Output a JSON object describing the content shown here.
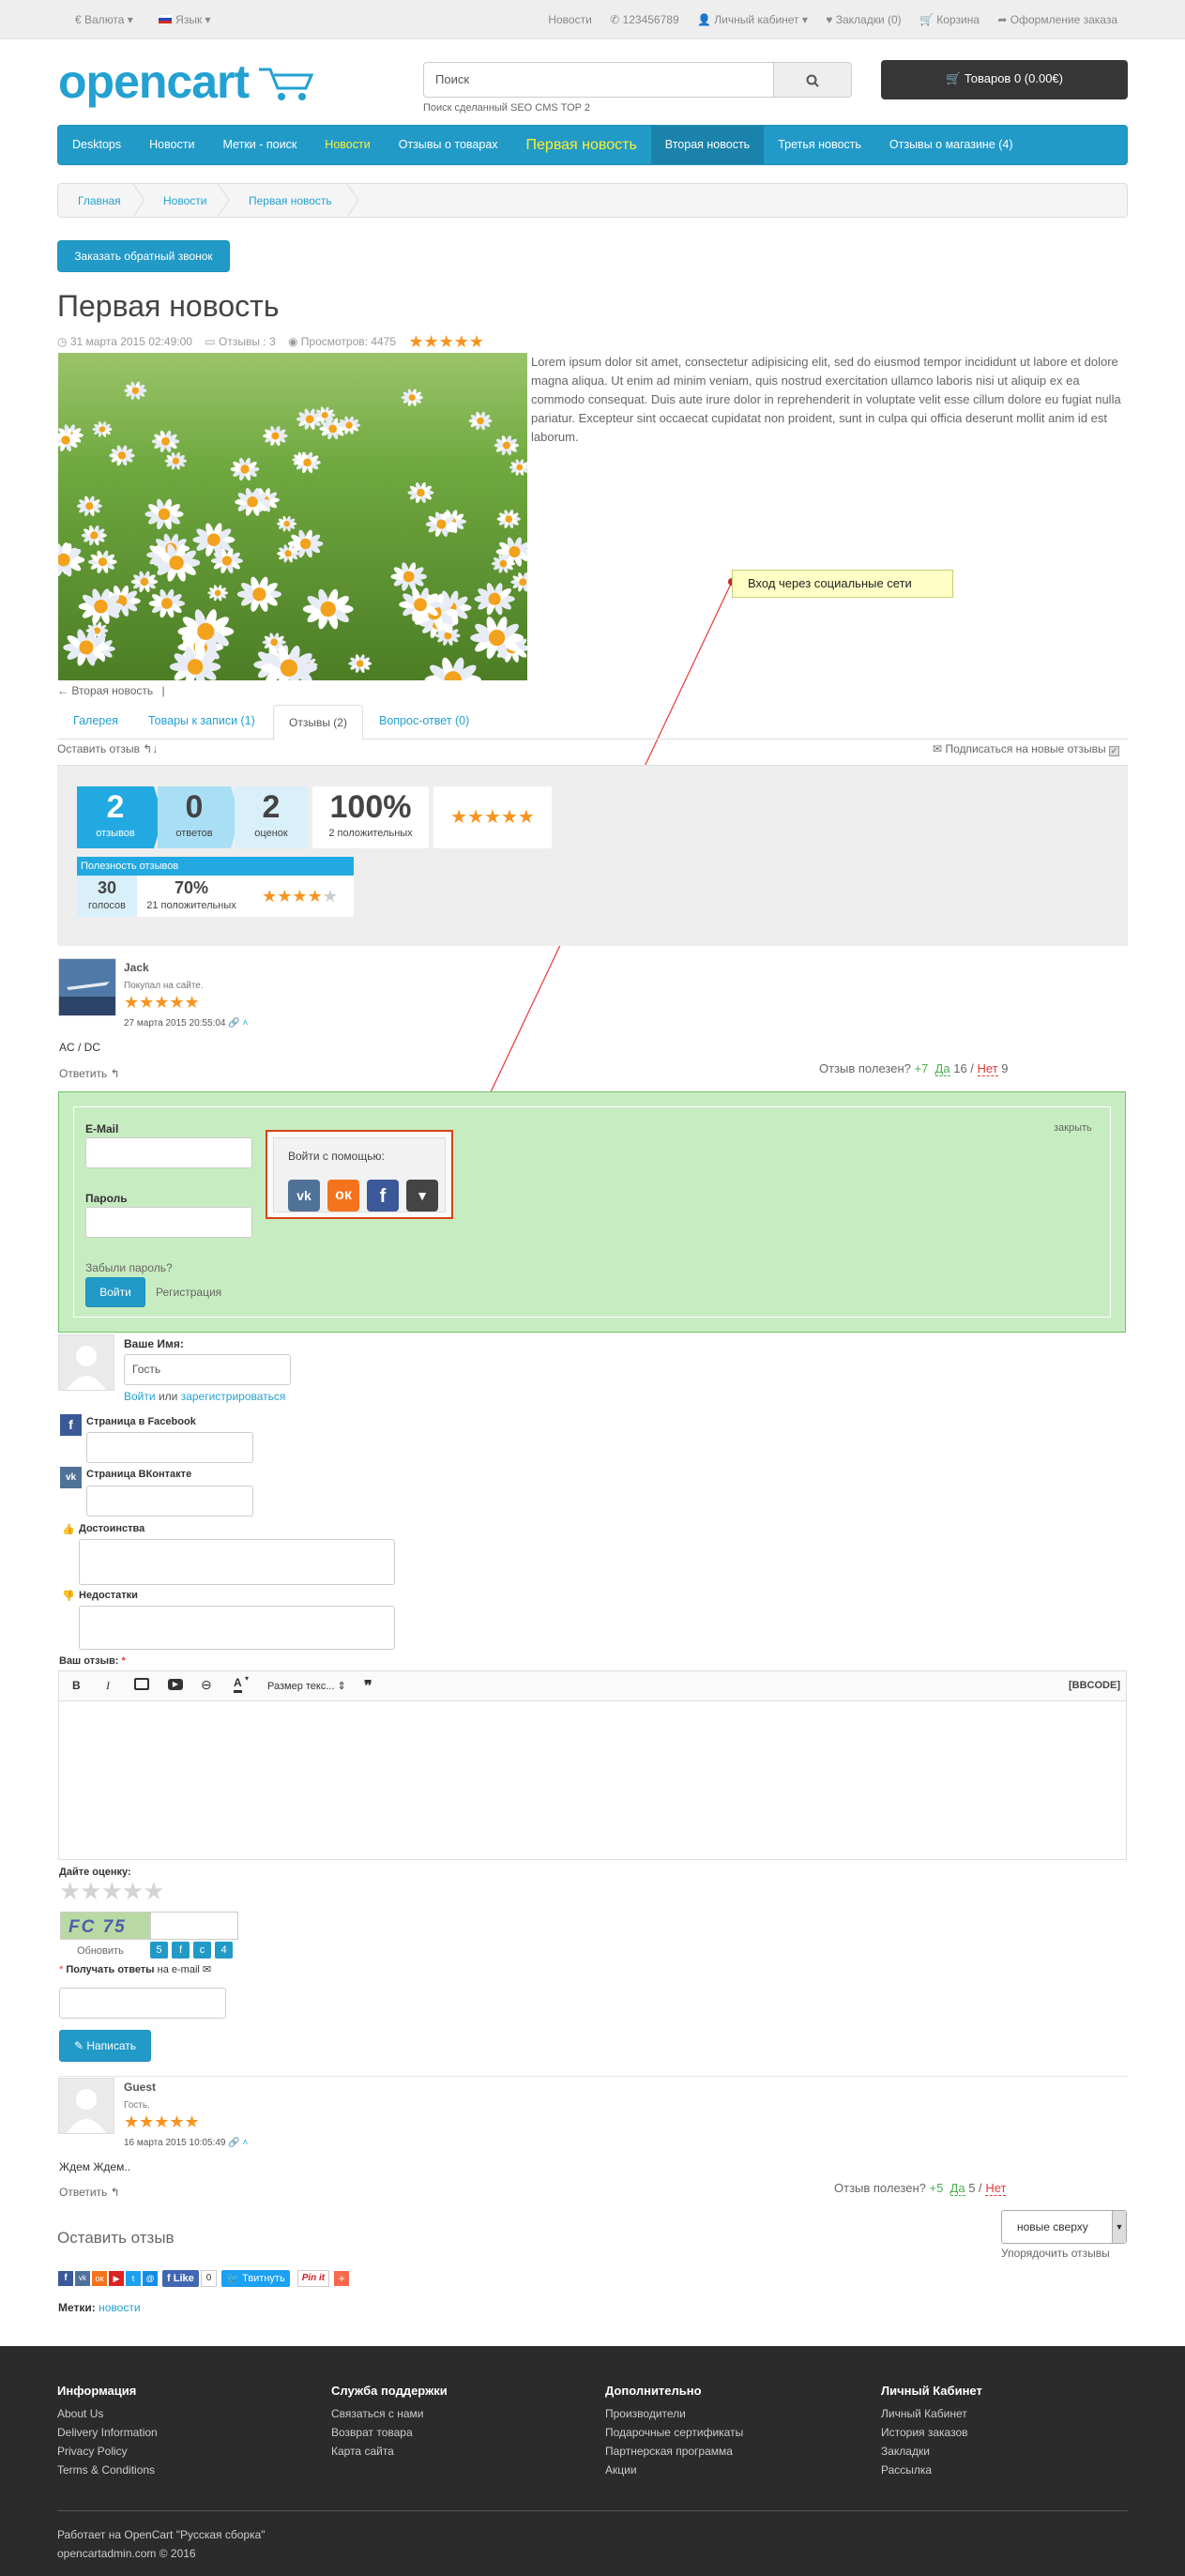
{
  "topbar": {
    "currency": "€ Валюта ▾",
    "language": "Язык ▾",
    "news": "Новости",
    "phone": "123456789",
    "account": "Личный кабинет ▾",
    "wishlist": "Закладки (0)",
    "cart": "Корзина",
    "checkout": "Оформление заказа"
  },
  "header": {
    "logo_text": "opencart",
    "search_placeholder": "Поиск",
    "seo_link": "Поиск сделанный SEO CMS TOP 2",
    "cart_button": "Товаров 0 (0.00€)"
  },
  "menu": [
    "Desktops",
    "Новости",
    "Метки - поиск",
    "Новости",
    "Отзывы о товарах",
    "Первая новость",
    "Вторая новость",
    "Третья новость",
    "Отзывы о магазине (4)"
  ],
  "breadcrumb": [
    "Главная",
    "Новости",
    "Первая новость"
  ],
  "callback_button": "Заказать обратный звонок",
  "article": {
    "title": "Первая новость",
    "date": "31 марта 2015 02:49:00",
    "reviews": "Отзывы : 3",
    "views": "Просмотров: 4475",
    "rating": "★★★★★",
    "body": "Lorem ipsum dolor sit amet, consectetur adipisicing elit, sed do eiusmod tempor incididunt ut labore et dolore magna aliqua. Ut enim ad minim veniam, quis nostrud exercitation ullamco laboris nisi ut aliquip ex ea commodo consequat. Duis aute irure dolor in reprehenderit in voluptate velit esse cillum dolore eu fugiat nulla pariatur. Excepteur sint occaecat cupidatat non proident, sunt in culpa qui officia deserunt mollit anim id est laborum.",
    "prev_link": "← Вторая новость",
    "prev_sep": "|"
  },
  "annotation": "Вход через социальные сети",
  "tabs": [
    "Галерея",
    "Товары к записи (1)",
    "Отзывы (2)",
    "Вопрос-ответ (0)"
  ],
  "leave_review": "Оставить отзыв",
  "subscribe": "Подписаться на новые отзывы",
  "stats": {
    "reviews_n": "2",
    "reviews_l": "отзывов",
    "answers_n": "0",
    "answers_l": "ответов",
    "ratings_n": "2",
    "ratings_l": "оценок",
    "pct_n": "100%",
    "pct_l": "2 положительных",
    "stars": "★★★★★",
    "help_title": "Полезность отзывов",
    "votes_n": "30",
    "votes_l": "голосов",
    "pos_n": "70%",
    "pos_l": "21 положительных",
    "help_stars": "★★★★",
    "help_star_empty": "★"
  },
  "review1": {
    "author": "Jack",
    "bought": "Покупал на сайте.",
    "stars": "★★★★★",
    "date": "27 марта 2015 20:55:04",
    "text": "AC / DC",
    "reply": "Ответить",
    "useful": "Отзыв полезен?",
    "plus": "+7",
    "yes": "Да",
    "yes_n": "16 /",
    "no": "Нет",
    "no_n": "9"
  },
  "login": {
    "email_label": "E-Mail",
    "password_label": "Пароль",
    "forgot": "Забыли пароль?",
    "login_btn": "Войти",
    "register": "Регистрация",
    "close": "закрыть",
    "social_title": "Войти с помощью:"
  },
  "form": {
    "name_label": "Ваше Имя:",
    "name_value": "Гость",
    "login_or": "Войти",
    "or_text": "или",
    "register_link": "зарегистрироваться",
    "facebook_label": "Страница в Facebook",
    "vk_label": "Страница ВКонтакте",
    "pros_label": "Достоинства",
    "cons_label": "Недостатки",
    "review_label": "Ваш отзыв:",
    "required": "*",
    "font_size": "Размер текс...",
    "bbcode": "[BBCODE]",
    "rate_label": "Дайте оценку:",
    "rate_stars": "★★★★★",
    "captcha_text": "FC 75",
    "refresh": "Обновить",
    "captcha_keys": [
      "5",
      "f",
      "c",
      "4"
    ],
    "notify_label": "Получать ответы",
    "notify_rest": "на e-mail",
    "submit": "Написать"
  },
  "review2": {
    "author": "Guest",
    "bought": "Гость.",
    "stars": "★★★★★",
    "date": "16 марта 2015 10:05:49",
    "text": "Ждем Ждем..",
    "reply": "Ответить",
    "useful": "Отзыв полезен?",
    "plus": "+5",
    "yes": "Да",
    "yes_n": "5 /",
    "no": "Нет"
  },
  "bottom": {
    "leave_review": "Оставить отзыв",
    "sort_value": "новые сверху",
    "sort_label": "Упорядочить отзывы",
    "like": "Like",
    "like_count": "0",
    "tweet": "Твитнуть",
    "pinit": "Pin it",
    "tags_label": "Метки:",
    "tag": "новости"
  },
  "footer": {
    "col1_title": "Информация",
    "col1": [
      "About Us",
      "Delivery Information",
      "Privacy Policy",
      "Terms & Conditions"
    ],
    "col2_title": "Служба поддержки",
    "col2": [
      "Связаться с нами",
      "Возврат товара",
      "Карта сайта"
    ],
    "col3_title": "Дополнительно",
    "col3": [
      "Производители",
      "Подарочные сертификаты",
      "Партнерская программа",
      "Акции"
    ],
    "col4_title": "Личный Кабинет",
    "col4": [
      "Личный Кабинет",
      "История заказов",
      "Закладки",
      "Рассылка"
    ],
    "powered_prefix": "Работает на",
    "powered_link": "OpenCart \"Русская сборка\"",
    "copyright": "opencartadmin.com © 2016"
  },
  "colors": {
    "accent": "#229ac8",
    "stars": "#f7931e",
    "green_panel": "#c8ecc1",
    "footer": "#2b2b2b"
  }
}
